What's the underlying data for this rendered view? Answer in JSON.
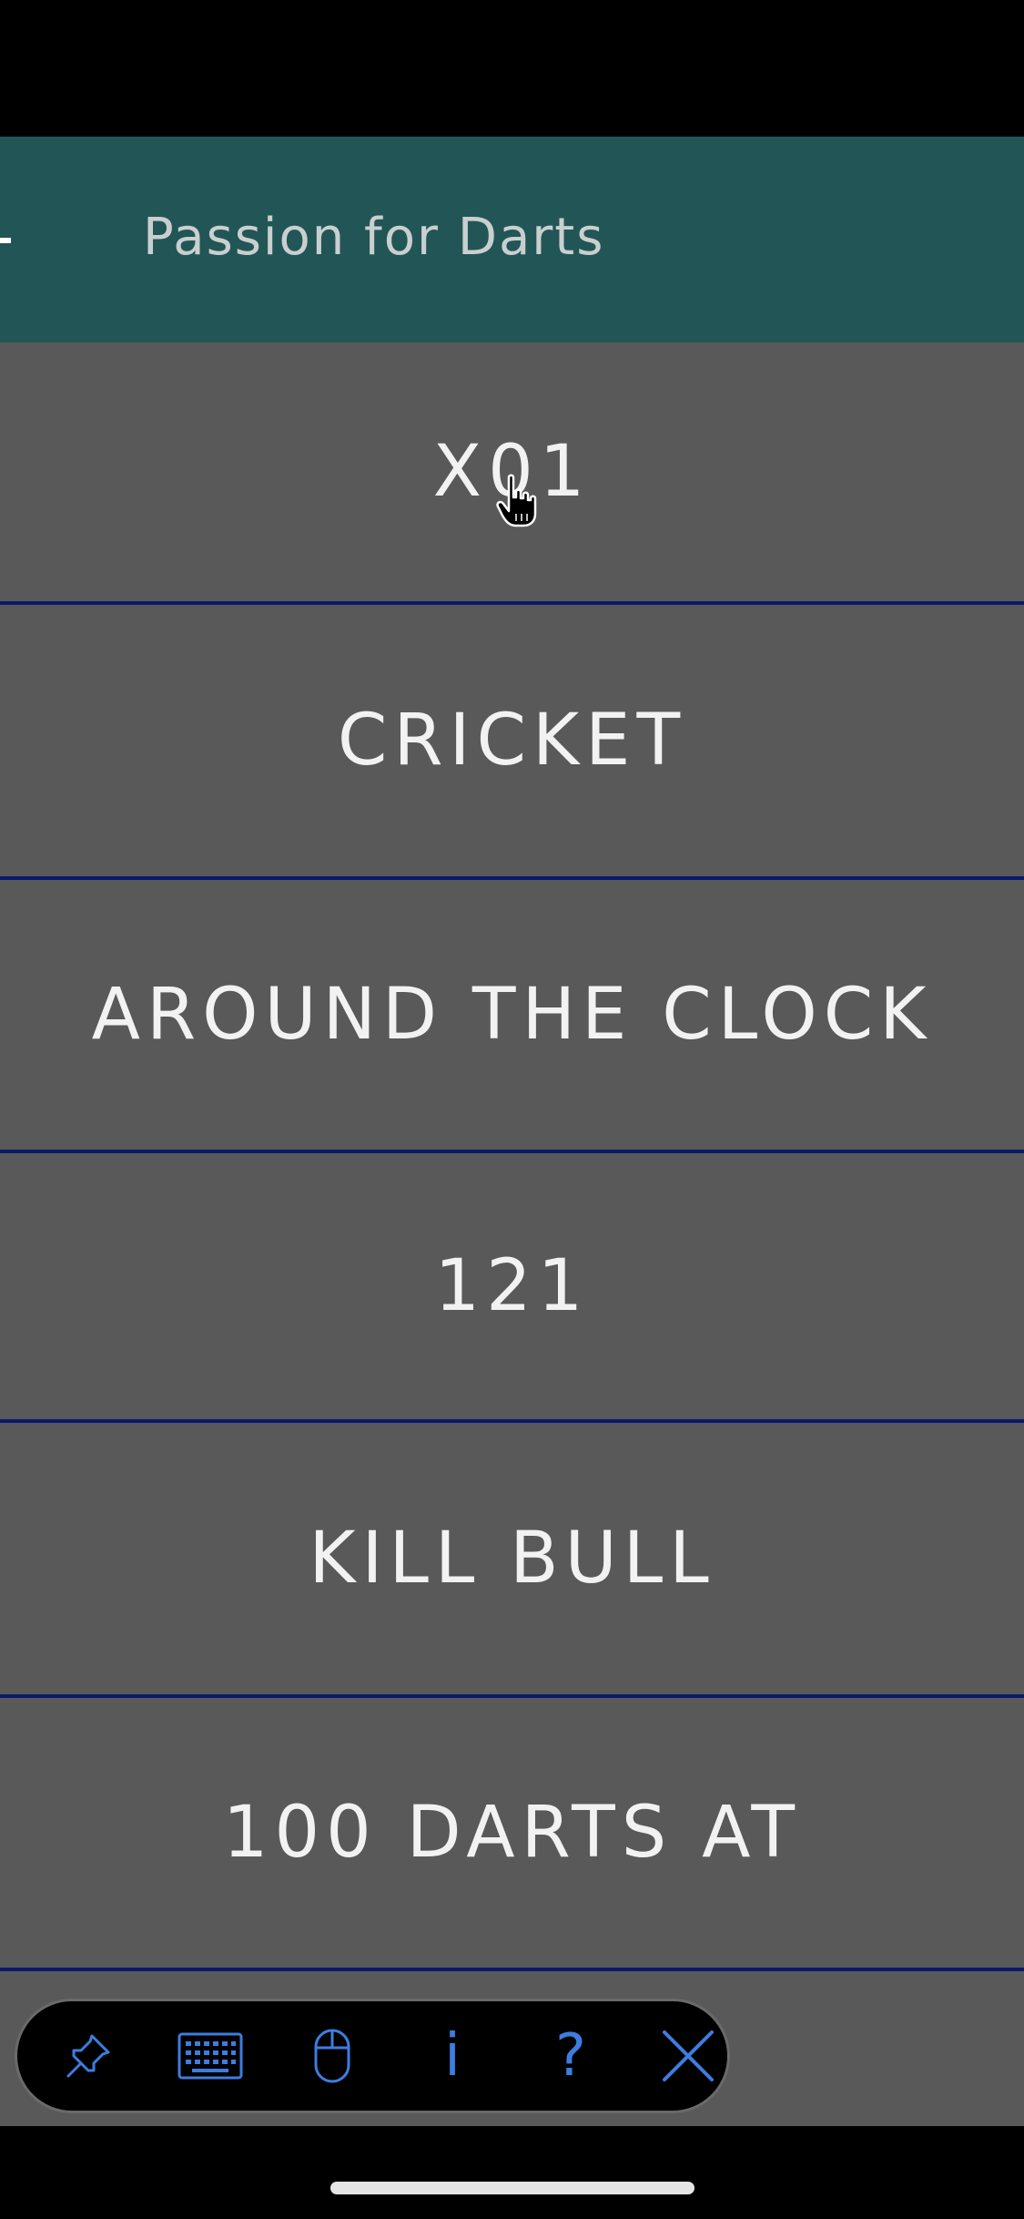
{
  "app": {
    "title": "Passion for Darts"
  },
  "menu": {
    "items": [
      {
        "label": "X01"
      },
      {
        "label": "CRICKET"
      },
      {
        "label": "AROUND THE CLOCK"
      },
      {
        "label": "121"
      },
      {
        "label": "KILL BULL"
      },
      {
        "label": "100 DARTS AT"
      }
    ]
  },
  "toolbar": {
    "tools": [
      {
        "icon": "pin-icon"
      },
      {
        "icon": "keyboard-icon"
      },
      {
        "icon": "mouse-icon"
      },
      {
        "icon": "info-icon",
        "glyph": "i"
      },
      {
        "icon": "help-icon",
        "glyph": "?"
      },
      {
        "icon": "close-icon"
      }
    ]
  },
  "colors": {
    "app_bar": "#225556",
    "list_background": "#595959",
    "divider": "#0a1a6a",
    "toolbar_icon": "#3d7de0"
  }
}
